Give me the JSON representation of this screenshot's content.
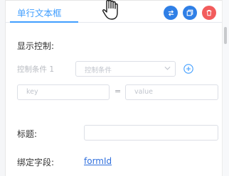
{
  "header": {
    "title": "单行文本框"
  },
  "actions": {
    "swap_icon": "swap-icon",
    "copy_icon": "copy-icon",
    "delete_icon": "delete-icon"
  },
  "display_control": {
    "section_title": "显示控制:",
    "condition_label": "控制条件 1",
    "condition_select_placeholder": "控制条件",
    "key_placeholder": "key",
    "equals_sign": "=",
    "value_placeholder": "value"
  },
  "fields": {
    "title_label": "标题:",
    "title_value": "",
    "bind_label": "绑定字段:",
    "bind_value": "formId"
  },
  "colors": {
    "accent": "#409eff",
    "action_blue": "#2f7fe6",
    "danger": "#f25c5c",
    "link": "#2f6fdd"
  }
}
